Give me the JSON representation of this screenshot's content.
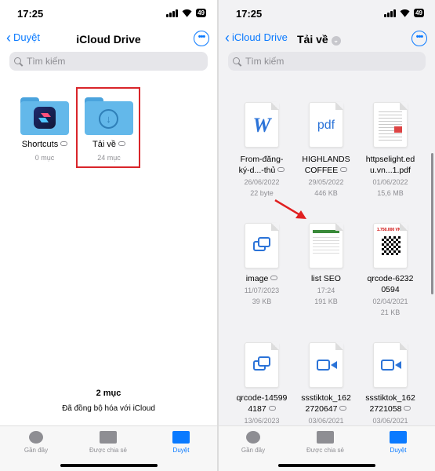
{
  "left": {
    "status": {
      "time": "17:25",
      "battery": "49"
    },
    "nav": {
      "back_label": "Duyệt",
      "title": "iCloud Drive",
      "more_label": "•••"
    },
    "search": {
      "placeholder": "Tìm kiếm"
    },
    "folders": [
      {
        "name": "Shortcuts",
        "count": "0 mục"
      },
      {
        "name": "Tải về",
        "count": "24 mục"
      }
    ],
    "footer": {
      "count": "2 mục",
      "sync": "Đã đồng bộ hóa với iCloud"
    },
    "tabs": [
      {
        "label": "Gần đây"
      },
      {
        "label": "Được chia sẻ"
      },
      {
        "label": "Duyệt"
      }
    ]
  },
  "right": {
    "status": {
      "time": "17:25",
      "battery": "49"
    },
    "nav": {
      "back_label": "iCloud Drive",
      "title": "Tải về",
      "more_label": "•••"
    },
    "search": {
      "placeholder": "Tìm kiếm"
    },
    "files": [
      {
        "name1": "From-đăng-",
        "name2": "ký-d...-thủ",
        "date": "26/06/2022",
        "size": "22 byte",
        "thumb": "W"
      },
      {
        "name1": "HIGHLANDS",
        "name2": "COFFEE",
        "date": "29/05/2022",
        "size": "446 KB",
        "thumb": "pdf"
      },
      {
        "name1": "httpselight.ed",
        "name2": "u.vn...1.pdf",
        "date": "01/06/2022",
        "size": "15,6 MB",
        "thumb": ""
      },
      {
        "name1": "image",
        "name2": "",
        "date": "11/07/2023",
        "size": "39 KB",
        "thumb": ""
      },
      {
        "name1": "list SEO",
        "name2": "",
        "date": "17:24",
        "size": "191 KB",
        "thumb": ""
      },
      {
        "name1": "qrcode-6232",
        "name2": "0594",
        "date": "02/04/2021",
        "size": "21 KB",
        "thumb": "1.750.000 VNĐ"
      },
      {
        "name1": "qrcode-14599",
        "name2": "4187",
        "date": "13/06/2023",
        "size": "",
        "thumb": ""
      },
      {
        "name1": "ssstiktok_162",
        "name2": "2720647",
        "date": "03/06/2021",
        "size": "",
        "thumb": ""
      },
      {
        "name1": "ssstiktok_162",
        "name2": "2721058",
        "date": "03/06/2021",
        "size": "",
        "thumb": ""
      }
    ],
    "tabs": [
      {
        "label": "Gần đây"
      },
      {
        "label": "Được chia sẻ"
      },
      {
        "label": "Duyệt"
      }
    ]
  },
  "colors": {
    "accent": "#0a7aff",
    "highlight": "#d9252a",
    "arrow": "#e02020",
    "folder": "#63b8ea"
  }
}
